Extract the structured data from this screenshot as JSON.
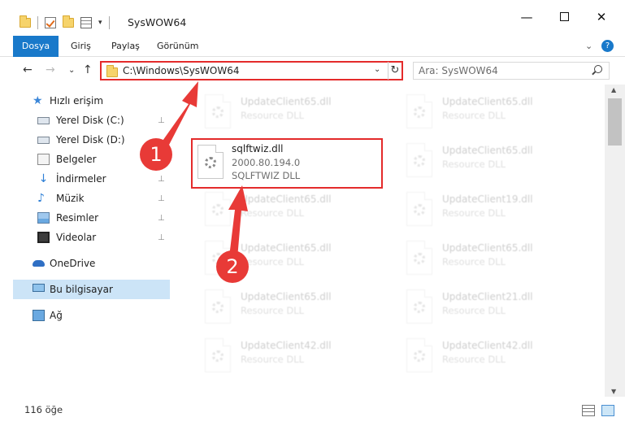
{
  "window": {
    "title": "SysWOW64",
    "minimize": "—",
    "close": "✕"
  },
  "ribbon": {
    "tabs": [
      "Dosya",
      "Giriş",
      "Paylaş",
      "Görünüm"
    ],
    "expand_glyph": "⌄",
    "help_glyph": "?"
  },
  "nav": {
    "back": "←",
    "forward": "→",
    "recent": "⌄",
    "up": "↑",
    "address": "C:\\Windows\\SysWOW64",
    "address_dropdown": "⌄",
    "refresh": "↻",
    "search_placeholder": "Ara: SysWOW64"
  },
  "sidebar": {
    "items": [
      {
        "label": "Hızlı erişim",
        "icon": "star-icon"
      },
      {
        "label": "Yerel Disk (C:)",
        "icon": "drive-icon",
        "pinned": true
      },
      {
        "label": "Yerel Disk (D:)",
        "icon": "drive-icon",
        "pinned": false
      },
      {
        "label": "Belgeler",
        "icon": "document-icon",
        "pinned": false
      },
      {
        "label": "İndirmeler",
        "icon": "download-icon",
        "pinned": true
      },
      {
        "label": "Müzik",
        "icon": "music-icon",
        "pinned": true
      },
      {
        "label": "Resimler",
        "icon": "pictures-icon",
        "pinned": true
      },
      {
        "label": "Videolar",
        "icon": "video-icon",
        "pinned": true
      },
      {
        "label": "OneDrive",
        "icon": "cloud-icon"
      },
      {
        "label": "Bu bilgisayar",
        "icon": "computer-icon",
        "selected": true
      },
      {
        "label": "Ağ",
        "icon": "network-icon"
      }
    ],
    "pin_glyph": "📌"
  },
  "files": {
    "focused": {
      "name": "sqlftwiz.dll",
      "version": "2000.80.194.0",
      "description": "SQLFTWIZ DLL"
    },
    "left_column": [
      {
        "name": "UpdateClient65.dll",
        "description": "Resource DLL"
      },
      {
        "name": "UpdateClient65.dll",
        "description": "Resource DLL"
      },
      {
        "name": "UpdateClient65.dll",
        "description": "Resource DLL"
      },
      {
        "name": "UpdateClient65.dll",
        "description": "Resource DLL"
      },
      {
        "name": "UpdateClient42.dll",
        "description": "Resource DLL"
      }
    ],
    "right_column": [
      {
        "name": "UpdateClient65.dll",
        "description": "Resource DLL"
      },
      {
        "name": "UpdateClient65.dll",
        "description": "Resource DLL"
      },
      {
        "name": "UpdateClient19.dll",
        "description": "Resource DLL"
      },
      {
        "name": "UpdateClient65.dll",
        "description": "Resource DLL"
      },
      {
        "name": "UpdateClient21.dll",
        "description": "Resource DLL"
      },
      {
        "name": "UpdateClient42.dll",
        "description": "Resource DLL"
      }
    ]
  },
  "scrollbar": {
    "up": "▲",
    "down": "▼"
  },
  "status": {
    "item_count": "116 öğe"
  },
  "annotations": {
    "step1": "1",
    "step2": "2",
    "color": "#e83a37"
  }
}
